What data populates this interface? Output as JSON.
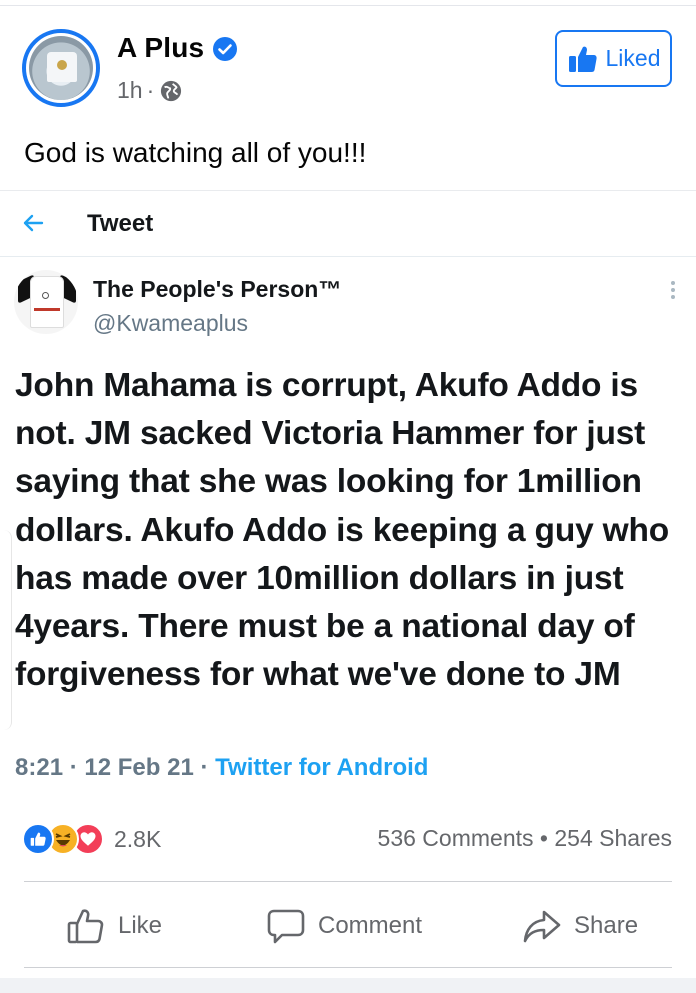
{
  "post": {
    "page_name": "A Plus",
    "time": "1h",
    "separator": "·",
    "liked_label": "Liked",
    "text": "God is watching all of you!!!"
  },
  "tweet_view": {
    "title": "Tweet"
  },
  "tweet": {
    "author_name": "The People's Person™",
    "handle": "@Kwameaplus",
    "body": "John Mahama is corrupt, Akufo Addo is not. JM sacked Victoria Hammer for just saying that she was looking for 1million dollars. Akufo Addo is keeping a guy who has made over 10million dollars in just 4years. There must be a national day of forgiveness for what we've done to JM",
    "time": "8:21",
    "date": "12 Feb 21",
    "sep": "·",
    "source": "Twitter for Android"
  },
  "engagement": {
    "reactions": [
      "like-icon",
      "haha-icon",
      "love-icon"
    ],
    "reaction_count": "2.8K",
    "comments": "536 Comments",
    "dot": "•",
    "shares": "254 Shares"
  },
  "actions": {
    "like": "Like",
    "comment": "Comment",
    "share": "Share"
  },
  "colors": {
    "facebook_blue": "#1877f2",
    "twitter_blue": "#1da1f2",
    "muted_text": "#65676b",
    "love_red": "#f33e58",
    "haha_yellow": "#f7b125"
  }
}
